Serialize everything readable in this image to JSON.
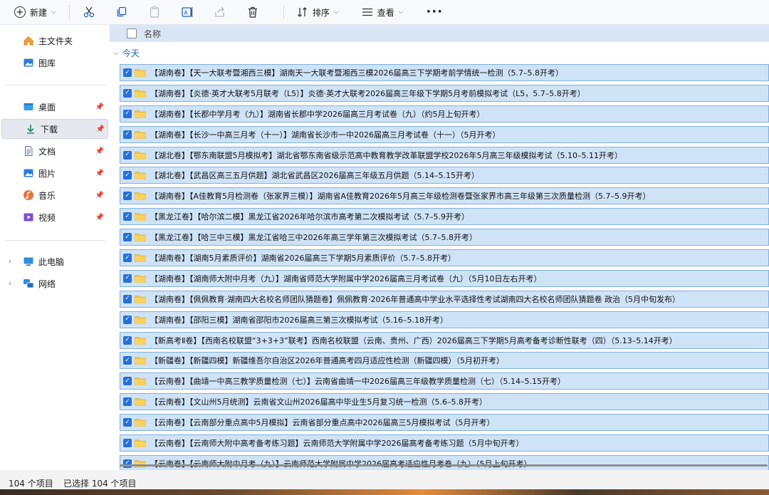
{
  "toolbar": {
    "new_label": "新建",
    "sort_label": "排序",
    "view_label": "查看",
    "more_label": "···"
  },
  "sidebar": {
    "items": [
      {
        "label": "主文件夹",
        "icon": "home-icon"
      },
      {
        "label": "图库",
        "icon": "gallery-icon"
      },
      {
        "label": "桌面",
        "icon": "desktop-folder-icon",
        "pinned": true
      },
      {
        "label": "下载",
        "icon": "download-icon",
        "pinned": true,
        "selected": true
      },
      {
        "label": "文档",
        "icon": "document-icon",
        "pinned": true
      },
      {
        "label": "图片",
        "icon": "pictures-icon",
        "pinned": true
      },
      {
        "label": "音乐",
        "icon": "music-icon",
        "pinned": true
      },
      {
        "label": "视频",
        "icon": "video-icon",
        "pinned": true
      },
      {
        "label": "此电脑",
        "icon": "computer-icon"
      },
      {
        "label": "网络",
        "icon": "network-icon"
      }
    ]
  },
  "content": {
    "column_name": "名称",
    "group_label": "今天",
    "files": [
      "【湖南卷】【天一大联考暨湘西三模】湖南天一大联考暨湘西三模2026届高三下学期考前学情统一检测（5.7–5.8开考）",
      "【湖南卷】【炎德·英才大联考5月联考（L5）】炎德·英才大联考2026届高三年级下学期5月考前模拟考试（L5，5.7–5.8开考）",
      "【湖南卷】【长郡中学月考（九）】湖南省长郡中学2026届高三月考试卷（九）（约5月上旬开考）",
      "【湖南卷】【长沙一中高三月考（十一）】湖南省长沙市一中2026届高三月考试卷（十一）（5月开考）",
      "【湖北卷】【鄂东南联盟5月模拟考】湖北省鄂东南省级示范高中教育教学改革联盟学校2026年5月高三年级模拟考试（5.10–5.11开考）",
      "【湖北卷】【武昌区高三五月供题】湖北省武昌区2026届高三年级五月供题（5.14–5.15开考）",
      "【湖南卷】【A佳教育5月检测卷（张家界三模）】湖南省A佳教育2026年5月高三年级检测卷暨张家界市高三年级第三次质量检测（5.7–5.9开考）",
      "【黑龙江卷】【哈尔滨二模】黑龙江省2026年哈尔滨市高考第二次模拟考试（5.7–5.9开考）",
      "【黑龙江卷】【哈三中三模】黑龙江省哈三中2026年高三学年第三次模拟考试（5.7–5.8开考）",
      "【湖南卷】【湖南5月素质评价】湖南省2026届高三下学期5月素质评价（5.7–5.8开考）",
      "【湖南卷】【湖南师大附中月考（九）】湖南省师范大学附属中学2026届高三月考试卷（九）（5月10日左右开考）",
      "【湖南卷】【佩佩教育·湖南四大名校名师团队猜题卷】佩佩教育·2026年普通高中学业水平选择性考试湖南四大名校名师团队猜题卷 政治（5月中旬发布）",
      "【湖南卷】【邵阳三模】湖南省邵阳市2026届高三第三次模拟考试（5.16–5.18开考）",
      "【新高考Ⅱ卷】【西南名校联盟“3+3+3”联考】西南名校联盟（云南、贵州、广西）2026届高三下学期5月高考备考诊断性联考（四）（5.13–5.14开考）",
      "【新疆卷】【新疆四模】新疆维吾尔自治区2026年普通高考四月适应性检测（新疆四模）（5月初开考）",
      "【云南卷】【曲靖一中高三教学质量检测（七）】云南省曲靖一中2026届高三年级教学质量检测（七）（5.14–5.15开考）",
      "【云南卷】【文山州5月统测】云南省文山州2026届高中毕业生5月复习统一检测（5.6–5.8开考）",
      "【云南卷】【云南部分重点高中5月模拟】云南省部分重点高中2026届高三5月模拟考试（5月开考）",
      "【云南卷】【云南师大附中高考备考练习题】云南师范大学附属中学2026届高考备考练习题（5月中旬开考）",
      "【云南卷】【云南师大附中月考（九）】云南师范大学附属中学2026届高考适应性月考卷（九）（5月上旬开考）"
    ]
  },
  "status": {
    "item_count": "104 个项目",
    "selected_count": "已选择 104 个项目"
  },
  "colors": {
    "selection_fill": "#cfe3f7",
    "selection_border": "#7fb0e0",
    "checkbox": "#2a6fd6",
    "folder": "#f5c342"
  }
}
